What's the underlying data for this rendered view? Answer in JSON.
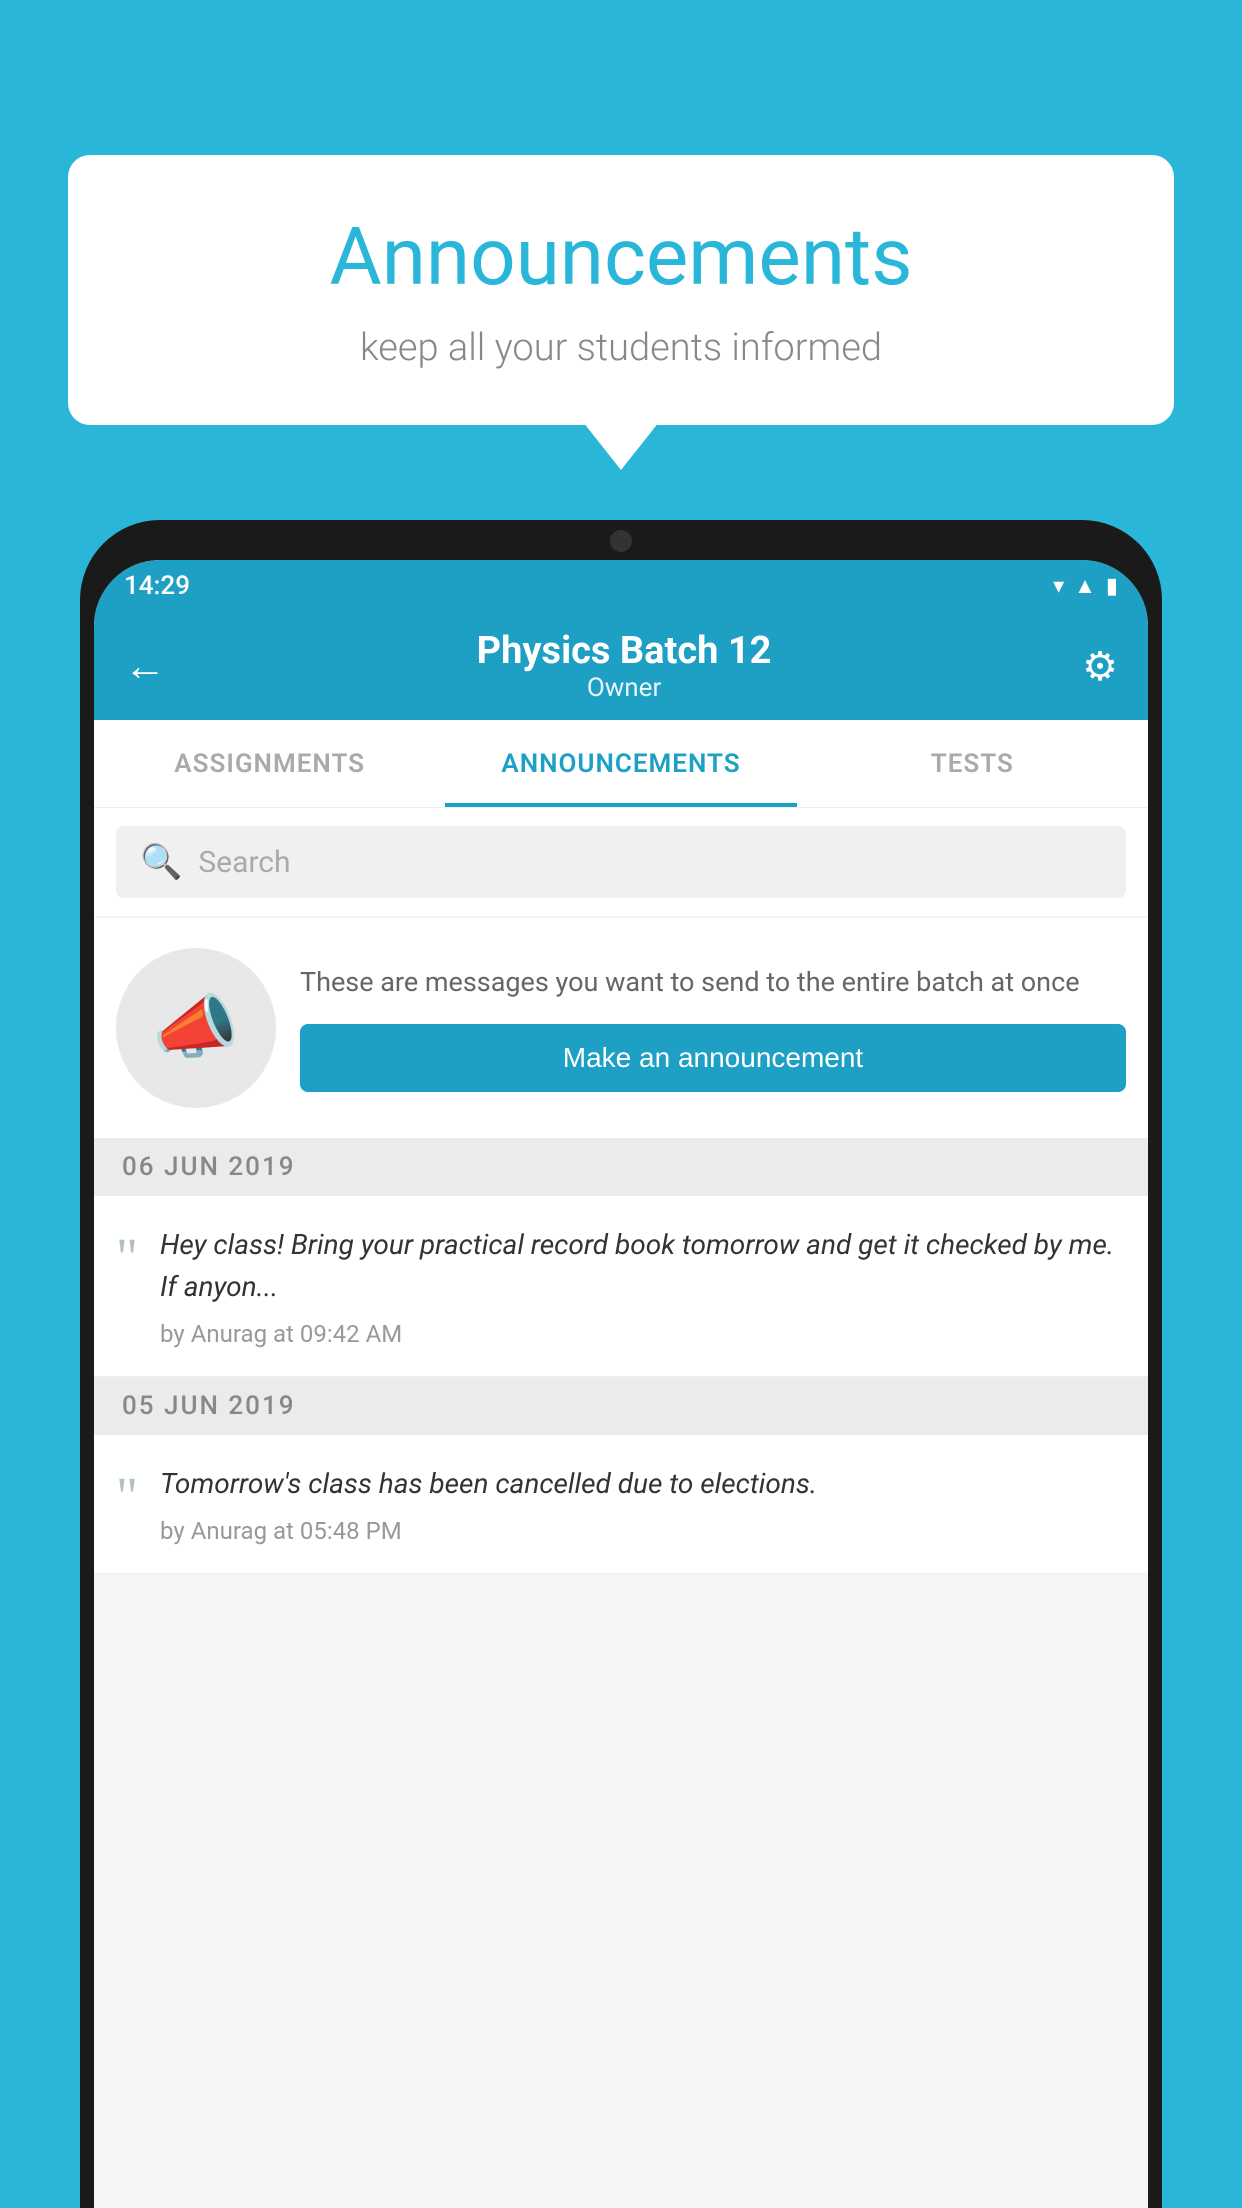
{
  "background_color": "#29b6d8",
  "speech_bubble": {
    "title": "Announcements",
    "subtitle": "keep all your students informed"
  },
  "status_bar": {
    "time": "14:29",
    "icons": [
      "wifi",
      "signal",
      "battery"
    ]
  },
  "header": {
    "title": "Physics Batch 12",
    "subtitle": "Owner",
    "back_label": "←",
    "settings_label": "⚙"
  },
  "tabs": [
    {
      "label": "ASSIGNMENTS",
      "active": false
    },
    {
      "label": "ANNOUNCEMENTS",
      "active": true
    },
    {
      "label": "TESTS",
      "active": false
    },
    {
      "label": "...",
      "active": false
    }
  ],
  "search": {
    "placeholder": "Search"
  },
  "promo": {
    "description": "These are messages you want to send to the entire batch at once",
    "button_label": "Make an announcement"
  },
  "announcements": [
    {
      "date": "06  JUN  2019",
      "message": "Hey class! Bring your practical record book tomorrow and get it checked by me. If anyon...",
      "meta": "by Anurag at 09:42 AM"
    },
    {
      "date": "05  JUN  2019",
      "message": "Tomorrow's class has been cancelled due to elections.",
      "meta": "by Anurag at 05:48 PM"
    }
  ]
}
